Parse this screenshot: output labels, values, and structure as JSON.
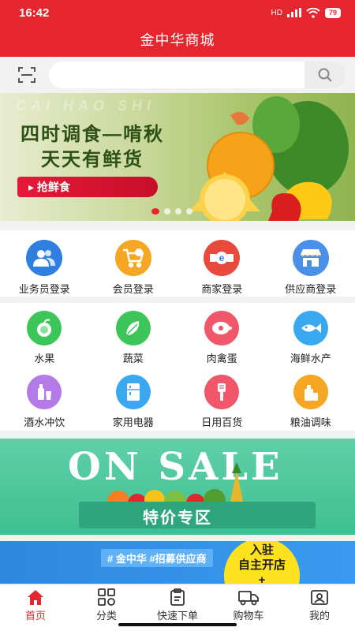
{
  "status": {
    "time": "16:42",
    "network": "HD",
    "battery": "79"
  },
  "header": {
    "title": "金中华商城"
  },
  "search": {
    "placeholder": ""
  },
  "banner": {
    "line1": "四时调食—啃秋",
    "line2": "天天有鲜货",
    "cta": "抢鲜食",
    "watermark": "CAI HAO SHI"
  },
  "login_row": [
    {
      "label": "业务员登录",
      "icon": "users-icon",
      "color": "#2f7fe0"
    },
    {
      "label": "会员登录",
      "icon": "cart-icon",
      "color": "#f5a623"
    },
    {
      "label": "商家登录",
      "icon": "store-e-icon",
      "color": "#e84a3c"
    },
    {
      "label": "供应商登录",
      "icon": "shop-awning-icon",
      "color": "#4a8fe8"
    }
  ],
  "categories": [
    {
      "label": "水果",
      "icon": "fruit-icon",
      "color": "#3cc65a"
    },
    {
      "label": "蔬菜",
      "icon": "vegetable-icon",
      "color": "#3cc65a"
    },
    {
      "label": "肉禽蛋",
      "icon": "meat-icon",
      "color": "#f0576a"
    },
    {
      "label": "海鲜水产",
      "icon": "fish-icon",
      "color": "#3aa8f0"
    },
    {
      "label": "酒水冲饮",
      "icon": "drinks-icon",
      "color": "#b47be8"
    },
    {
      "label": "家用电器",
      "icon": "fridge-icon",
      "color": "#3aa8f0"
    },
    {
      "label": "日用百货",
      "icon": "brush-icon",
      "color": "#f0576a"
    },
    {
      "label": "粮油调味",
      "icon": "oil-icon",
      "color": "#f5a623"
    }
  ],
  "sale": {
    "headline": "ON SALE",
    "title": "特价专区"
  },
  "recruit": {
    "tag": "# 金中华 #招募供应商",
    "line1": "入驻",
    "line2": "自主开店",
    "line3": "+"
  },
  "bottom_nav": [
    {
      "label": "首页",
      "icon": "home-icon",
      "active": true
    },
    {
      "label": "分类",
      "icon": "grid-icon",
      "active": false
    },
    {
      "label": "快速下单",
      "icon": "clipboard-icon",
      "active": false
    },
    {
      "label": "购物车",
      "icon": "truck-icon",
      "active": false
    },
    {
      "label": "我的",
      "icon": "profile-icon",
      "active": false
    }
  ],
  "colors": {
    "brand_red": "#e6262e",
    "background": "#f2f2f2"
  }
}
